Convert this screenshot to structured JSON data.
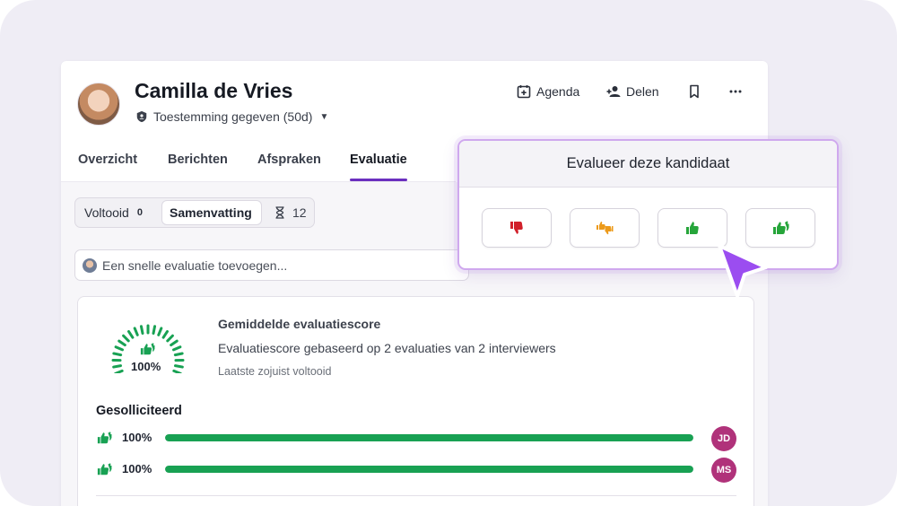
{
  "candidate": {
    "name": "Camilla de Vries",
    "consent_label": "Toestemming gegeven (50d)"
  },
  "header_actions": {
    "agenda": "Agenda",
    "share": "Delen"
  },
  "tabs": [
    {
      "label": "Overzicht"
    },
    {
      "label": "Berichten"
    },
    {
      "label": "Afspraken"
    },
    {
      "label": "Evaluatie",
      "active": true
    }
  ],
  "segmented": {
    "completed_label": "Voltooid",
    "completed_count": "0",
    "summary_label": "Samenvatting",
    "pending_count": "12"
  },
  "quick_eval": {
    "placeholder": "Een snelle evaluatie toevoegen..."
  },
  "score": {
    "gauge_value": "100%",
    "title": "Gemiddelde evaluatiescore",
    "description": "Evaluatiescore gebaseerd op 2 evaluaties van 2 interviewers",
    "subtitle": "Laatste zojuist voltooid"
  },
  "stage": {
    "title": "Gesolliciteerd",
    "rows": [
      {
        "percent": "100%",
        "fraction": 1.0,
        "initials": "JD"
      },
      {
        "percent": "100%",
        "fraction": 1.0,
        "initials": "MS"
      }
    ]
  },
  "popup": {
    "title": "Evalueer deze kandidaat",
    "options": [
      {
        "icon": "thumbs-down-icon",
        "color": "#d1202a"
      },
      {
        "icon": "thumbs-mixed-icon",
        "color": "#ec9a1a"
      },
      {
        "icon": "thumbs-up-icon",
        "color": "#26a53a"
      },
      {
        "icon": "double-thumbs-up-icon",
        "color": "#26a53a"
      }
    ]
  },
  "colors": {
    "accent": "#6b2fbf",
    "progress": "#18a153",
    "badge": "#b0327a",
    "cursor": "#9b4df0"
  }
}
